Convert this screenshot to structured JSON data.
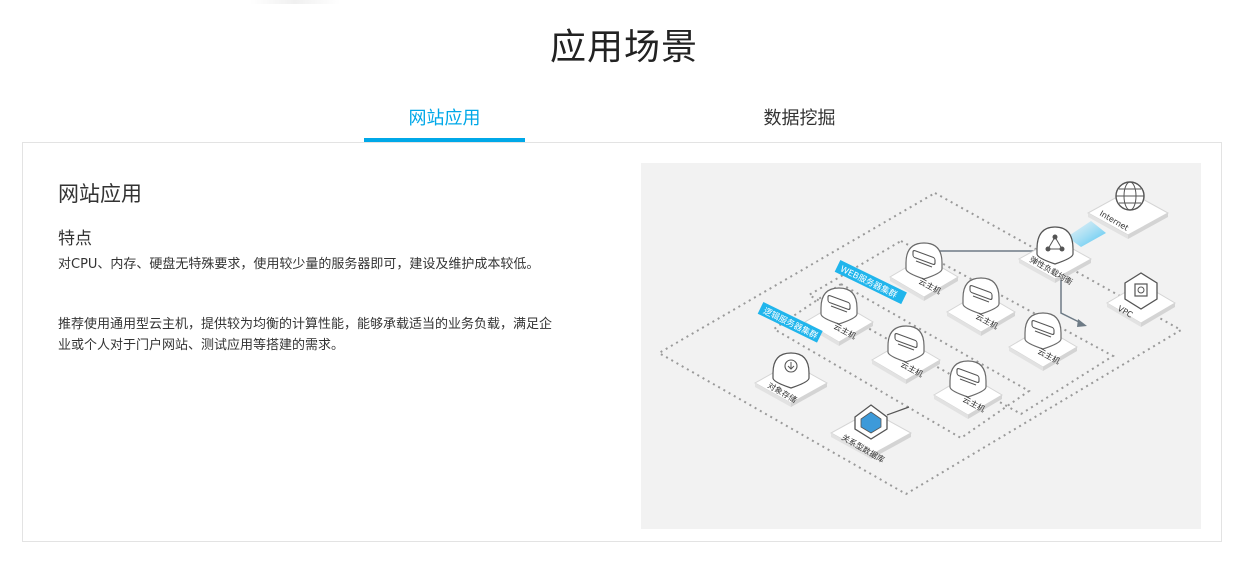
{
  "section": {
    "title": "应用场景"
  },
  "tabs": [
    {
      "label": "网站应用",
      "active": true
    },
    {
      "label": "数据挖掘",
      "active": false
    }
  ],
  "panel": {
    "title": "网站应用",
    "features_heading": "特点",
    "paragraphs": [
      "对CPU、内存、硬盘无特殊要求，使用较少量的服务器即可，建设及维护成本较低。",
      "推荐使用通用型云主机，提供较为均衡的计算性能，能够承载适当的业务负载，满足企业或个人对于门户网站、测试应用等搭建的需求。"
    ]
  },
  "diagram": {
    "internet": "Internet",
    "load_balancer": "弹性负载均衡",
    "vpc": "VPC",
    "web_cluster": "WEB服务器集群",
    "logic_cluster": "逻辑服务器集群",
    "cloud_host": "云主机",
    "object_storage": "对象存储",
    "relational_db": "关系型数据库"
  },
  "colors": {
    "accent": "#00a8e8",
    "diagram_bg": "#f2f2f2",
    "cluster_tag": "#20b5ec"
  }
}
